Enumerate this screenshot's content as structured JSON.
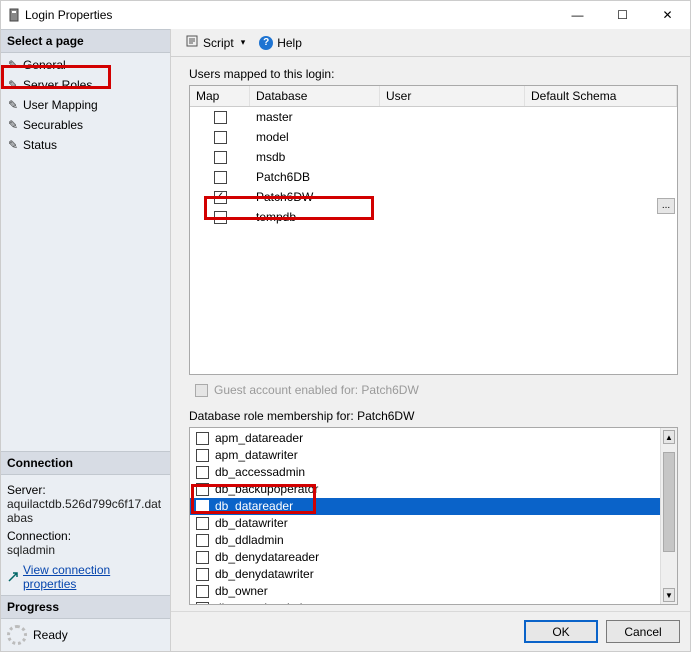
{
  "window": {
    "title": "Login Properties"
  },
  "win_controls": {
    "min": "—",
    "max": "☐",
    "close": "✕"
  },
  "sidebar": {
    "select_head": "Select a page",
    "pages": [
      {
        "label": "General"
      },
      {
        "label": "Server Roles"
      },
      {
        "label": "User Mapping"
      },
      {
        "label": "Securables"
      },
      {
        "label": "Status"
      }
    ],
    "connection_head": "Connection",
    "server_label": "Server:",
    "server_value": "aquilactdb.526d799c6f17.databas",
    "conn_label": "Connection:",
    "conn_value": "sqladmin",
    "view_conn_link": "View connection properties",
    "progress_head": "Progress",
    "progress_text": "Ready"
  },
  "toolbar": {
    "script": "Script",
    "help": "Help",
    "dropdown_glyph": "▾"
  },
  "mapping": {
    "caption": "Users mapped to this login:",
    "columns": {
      "map": "Map",
      "database": "Database",
      "user": "User",
      "schema": "Default Schema"
    },
    "rows": [
      {
        "checked": false,
        "database": "master",
        "user": "",
        "schema": ""
      },
      {
        "checked": false,
        "database": "model",
        "user": "",
        "schema": ""
      },
      {
        "checked": false,
        "database": "msdb",
        "user": "",
        "schema": ""
      },
      {
        "checked": false,
        "database": "Patch6DB",
        "user": "",
        "schema": ""
      },
      {
        "checked": true,
        "database": "Patch6DW",
        "user": "",
        "schema": "",
        "active": true
      },
      {
        "checked": false,
        "database": "tempdb",
        "user": "",
        "schema": ""
      }
    ],
    "ellipsis": "..."
  },
  "guest": {
    "label": "Guest account enabled for: Patch6DW",
    "checked": false
  },
  "roles": {
    "caption": "Database role membership for: Patch6DW",
    "items": [
      {
        "checked": false,
        "label": "apm_datareader"
      },
      {
        "checked": false,
        "label": "apm_datawriter"
      },
      {
        "checked": false,
        "label": "db_accessadmin"
      },
      {
        "checked": false,
        "label": "db_backupoperator"
      },
      {
        "checked": true,
        "label": "db_datareader",
        "selected": true
      },
      {
        "checked": false,
        "label": "db_datawriter"
      },
      {
        "checked": false,
        "label": "db_ddladmin"
      },
      {
        "checked": false,
        "label": "db_denydatareader"
      },
      {
        "checked": false,
        "label": "db_denydatawriter"
      },
      {
        "checked": false,
        "label": "db_owner"
      },
      {
        "checked": false,
        "label": "db_securityadmin"
      }
    ],
    "arrow_up": "▲",
    "arrow_down": "▼"
  },
  "footer": {
    "ok": "OK",
    "cancel": "Cancel"
  }
}
